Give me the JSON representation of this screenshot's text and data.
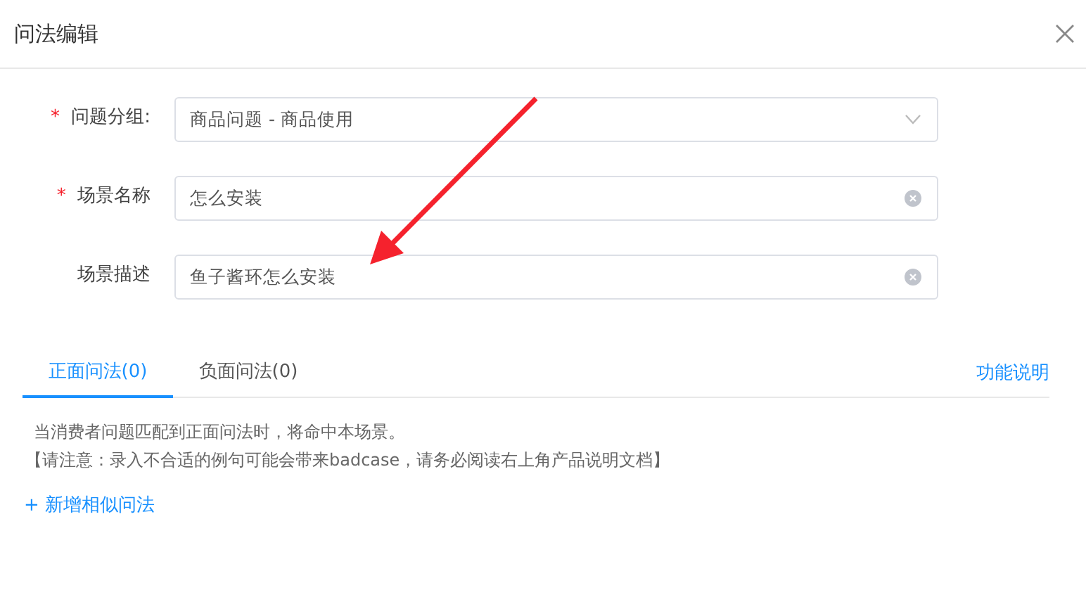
{
  "window": {
    "title": "问法编辑"
  },
  "form": [
    {
      "kind": "select",
      "label": "问题分组:",
      "required_mark": "*",
      "value": "商品问题 - 商品使用"
    },
    {
      "kind": "input",
      "label": "场景名称",
      "required_mark": "*",
      "value": "怎么安装"
    },
    {
      "kind": "input",
      "label": "场景描述",
      "value": "鱼子酱环怎么安装"
    }
  ],
  "tabs": [
    {
      "label": "正面问法(0)",
      "selected": true
    },
    {
      "label": "负面问法(0)",
      "selected": false
    }
  ],
  "help_link": "功能说明",
  "notes": [
    "当消费者问题匹配到正面问法时，将命中本场景。",
    "【请注意：录入不合适的例句可能会带来badcase，请务必阅读右上角产品说明文档】"
  ],
  "add_link": "+ 新增相似问法"
}
